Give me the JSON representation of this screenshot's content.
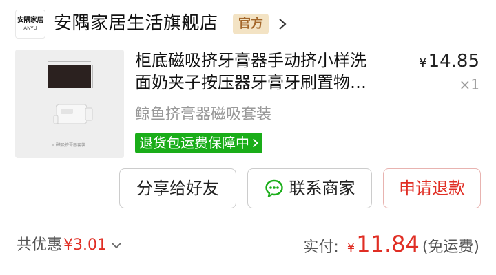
{
  "store": {
    "logo_cn": "安隅家居",
    "logo_en": "ANYU",
    "name": "安隅家居生活旗舰店",
    "badge": "官方"
  },
  "product": {
    "title_line1": "柜底磁吸挤牙膏器手动挤小样洗",
    "title_line2": "面奶夹子按压器牙膏牙刷置物…",
    "price_symbol": "¥",
    "price": "14.85",
    "quantity": "×1",
    "variant": "鲸鱼挤膏器磁吸套装",
    "thumbnail_caption": "磁吸挤膏器套装",
    "return_badge": "退货包运费保障中"
  },
  "actions": {
    "share": "分享给好友",
    "contact": "联系商家",
    "refund": "申请退款"
  },
  "summary": {
    "discount_label": "共优惠",
    "discount_amount": "¥3.01",
    "paid_label": "实付:",
    "paid_symbol": "¥",
    "paid_amount": "11.84",
    "shipping_note": "(免运费)"
  },
  "colors": {
    "accent_red": "#e02e24",
    "badge_green": "#1aad19",
    "official_bg": "#f3e3c4",
    "official_text": "#a4672b"
  },
  "icons": {
    "store_arrow": "chevron-right-icon",
    "return_arrow": "chevron-right-icon",
    "contact": "chat-bubble-icon",
    "discount_toggle": "chevron-down-icon"
  }
}
